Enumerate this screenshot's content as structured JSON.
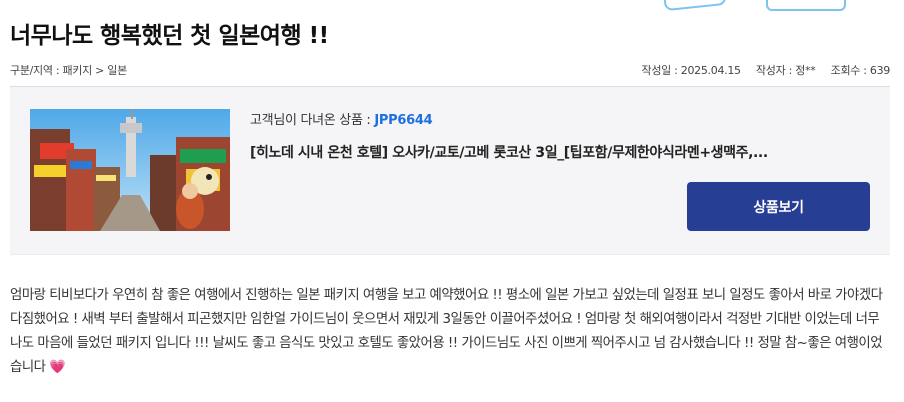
{
  "post": {
    "title": "너무나도 행복했던 첫 일본여행 !!",
    "category": "구분/지역 : 패키지 > 일본",
    "date": "작성일 : 2025.04.15",
    "author": "작성자 : 정**",
    "views": "조회수 : 639"
  },
  "product": {
    "label_prefix": "고객님이 다녀온 상품 : ",
    "code": "JPP6644",
    "name": "[히노데 시내 온천 호텔] 오사카/교토/고베 롯코산 3일_[팁포함/무제한야식라멘+생맥주,...",
    "view_button": "상품보기"
  },
  "review": {
    "body": "엄마랑 티비보다가 우연히 참 좋은 여행에서 진행하는 일본 패키지 여행을 보고 예약했어요 !! 평소에 일본 가보고 싶었는데 일정표 보니 일정도 좋아서 바로 가야겠다 다짐했어요 ! 새벽 부터 출발해서 피곤했지만 임한얼 가이드님이 웃으면서 재밌게 3일동안 이끌어주셨어요 ! 엄마랑 첫 해외여행이라서 걱정반 기대반 이었는데 너무나도 마음에 들었던 패키지 입니다 !!! 날씨도 좋고 음식도 맛있고 호텔도 좋았어용 !! 가이드님도 사진 이쁘게 찍어주시고 넘 감사했습니다 !! 정말 참~좋은 여행이었습니다",
    "emoji": "💗"
  },
  "colors": {
    "button_bg": "#263e94",
    "product_code": "#1e6fe0",
    "heart": "#ff3f9a"
  }
}
